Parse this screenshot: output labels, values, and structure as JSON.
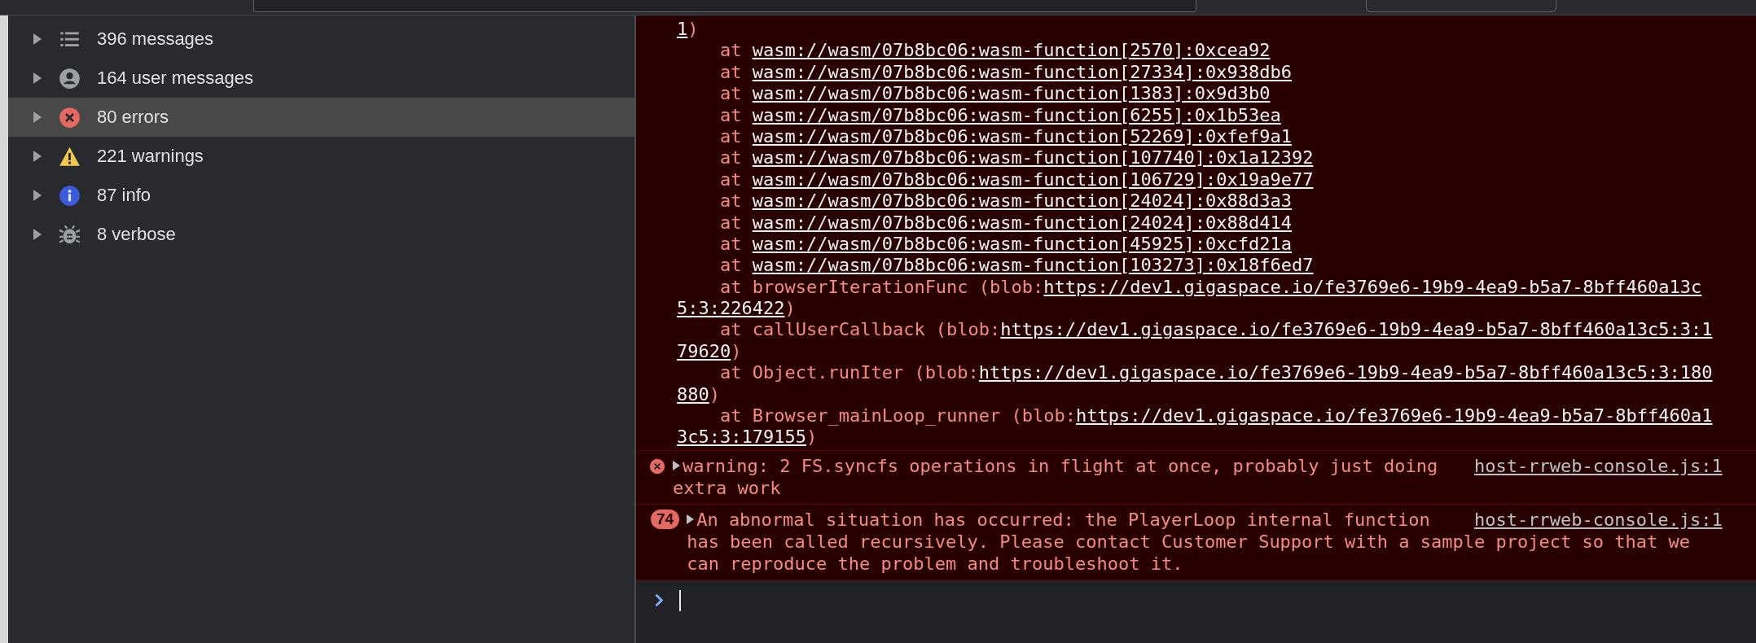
{
  "sidebar": {
    "items": [
      {
        "label": "396 messages",
        "kind": "list",
        "selected": false
      },
      {
        "label": "164 user messages",
        "kind": "user",
        "selected": false
      },
      {
        "label": "80 errors",
        "kind": "error",
        "selected": true
      },
      {
        "label": "221 warnings",
        "kind": "warning",
        "selected": false
      },
      {
        "label": "87 info",
        "kind": "info",
        "selected": false
      },
      {
        "label": "8 verbose",
        "kind": "verbose",
        "selected": false
      }
    ]
  },
  "console": {
    "trace_lines": [
      {
        "kind": "wrap",
        "parts": [
          {
            "kind": "link",
            "text": "1"
          },
          {
            "kind": "text",
            "text": ")"
          }
        ]
      },
      {
        "kind": "frame",
        "parts": [
          {
            "kind": "text",
            "text": "at "
          },
          {
            "kind": "link",
            "text": "wasm://wasm/07b8bc06:wasm-function[2570]:0xcea92"
          }
        ]
      },
      {
        "kind": "frame",
        "parts": [
          {
            "kind": "text",
            "text": "at "
          },
          {
            "kind": "link",
            "text": "wasm://wasm/07b8bc06:wasm-function[27334]:0x938db6"
          }
        ]
      },
      {
        "kind": "frame",
        "parts": [
          {
            "kind": "text",
            "text": "at "
          },
          {
            "kind": "link",
            "text": "wasm://wasm/07b8bc06:wasm-function[1383]:0x9d3b0"
          }
        ]
      },
      {
        "kind": "frame",
        "parts": [
          {
            "kind": "text",
            "text": "at "
          },
          {
            "kind": "link",
            "text": "wasm://wasm/07b8bc06:wasm-function[6255]:0x1b53ea"
          }
        ]
      },
      {
        "kind": "frame",
        "parts": [
          {
            "kind": "text",
            "text": "at "
          },
          {
            "kind": "link",
            "text": "wasm://wasm/07b8bc06:wasm-function[52269]:0xfef9a1"
          }
        ]
      },
      {
        "kind": "frame",
        "parts": [
          {
            "kind": "text",
            "text": "at "
          },
          {
            "kind": "link",
            "text": "wasm://wasm/07b8bc06:wasm-function[107740]:0x1a12392"
          }
        ]
      },
      {
        "kind": "frame",
        "parts": [
          {
            "kind": "text",
            "text": "at "
          },
          {
            "kind": "link",
            "text": "wasm://wasm/07b8bc06:wasm-function[106729]:0x19a9e77"
          }
        ]
      },
      {
        "kind": "frame",
        "parts": [
          {
            "kind": "text",
            "text": "at "
          },
          {
            "kind": "link",
            "text": "wasm://wasm/07b8bc06:wasm-function[24024]:0x88d3a3"
          }
        ]
      },
      {
        "kind": "frame",
        "parts": [
          {
            "kind": "text",
            "text": "at "
          },
          {
            "kind": "link",
            "text": "wasm://wasm/07b8bc06:wasm-function[24024]:0x88d414"
          }
        ]
      },
      {
        "kind": "frame",
        "parts": [
          {
            "kind": "text",
            "text": "at "
          },
          {
            "kind": "link",
            "text": "wasm://wasm/07b8bc06:wasm-function[45925]:0xcfd21a"
          }
        ]
      },
      {
        "kind": "frame",
        "parts": [
          {
            "kind": "text",
            "text": "at "
          },
          {
            "kind": "link",
            "text": "wasm://wasm/07b8bc06:wasm-function[103273]:0x18f6ed7"
          }
        ]
      },
      {
        "kind": "frame",
        "parts": [
          {
            "kind": "text",
            "text": "at browserIterationFunc (blob:"
          },
          {
            "kind": "link",
            "text": "https://dev1.gigaspace.io/fe3769e6-19b9-4ea9-b5a7-8bff460a13c"
          }
        ]
      },
      {
        "kind": "wrap",
        "parts": [
          {
            "kind": "link",
            "text": "5:3:226422"
          },
          {
            "kind": "text",
            "text": ")"
          }
        ]
      },
      {
        "kind": "frame",
        "parts": [
          {
            "kind": "text",
            "text": "at callUserCallback (blob:"
          },
          {
            "kind": "link",
            "text": "https://dev1.gigaspace.io/fe3769e6-19b9-4ea9-b5a7-8bff460a13c5:3:1"
          }
        ]
      },
      {
        "kind": "wrap",
        "parts": [
          {
            "kind": "link",
            "text": "79620"
          },
          {
            "kind": "text",
            "text": ")"
          }
        ]
      },
      {
        "kind": "frame",
        "parts": [
          {
            "kind": "text",
            "text": "at Object.runIter (blob:"
          },
          {
            "kind": "link",
            "text": "https://dev1.gigaspace.io/fe3769e6-19b9-4ea9-b5a7-8bff460a13c5:3:180"
          }
        ]
      },
      {
        "kind": "wrap",
        "parts": [
          {
            "kind": "link",
            "text": "880"
          },
          {
            "kind": "text",
            "text": ")"
          }
        ]
      },
      {
        "kind": "frame",
        "parts": [
          {
            "kind": "text",
            "text": "at Browser_mainLoop_runner (blob:"
          },
          {
            "kind": "link",
            "text": "https://dev1.gigaspace.io/fe3769e6-19b9-4ea9-b5a7-8bff460a1"
          }
        ]
      },
      {
        "kind": "wrap",
        "parts": [
          {
            "kind": "link",
            "text": "3c5:3:179155"
          },
          {
            "kind": "text",
            "text": ")"
          }
        ]
      }
    ],
    "messages": [
      {
        "kind": "error",
        "text": "warning: 2 FS.syncfs operations in flight at once, probably just doing",
        "continuation": "extra work",
        "source": "host-rrweb-console.js:1"
      },
      {
        "kind": "repeat",
        "count": "74",
        "text": "An abnormal situation has occurred: the PlayerLoop internal function",
        "continuation": "has been called recursively. Please contact Customer Support with a sample project so that we can reproduce the problem and troubleshoot it.",
        "source": "host-rrweb-console.js:1"
      }
    ]
  }
}
